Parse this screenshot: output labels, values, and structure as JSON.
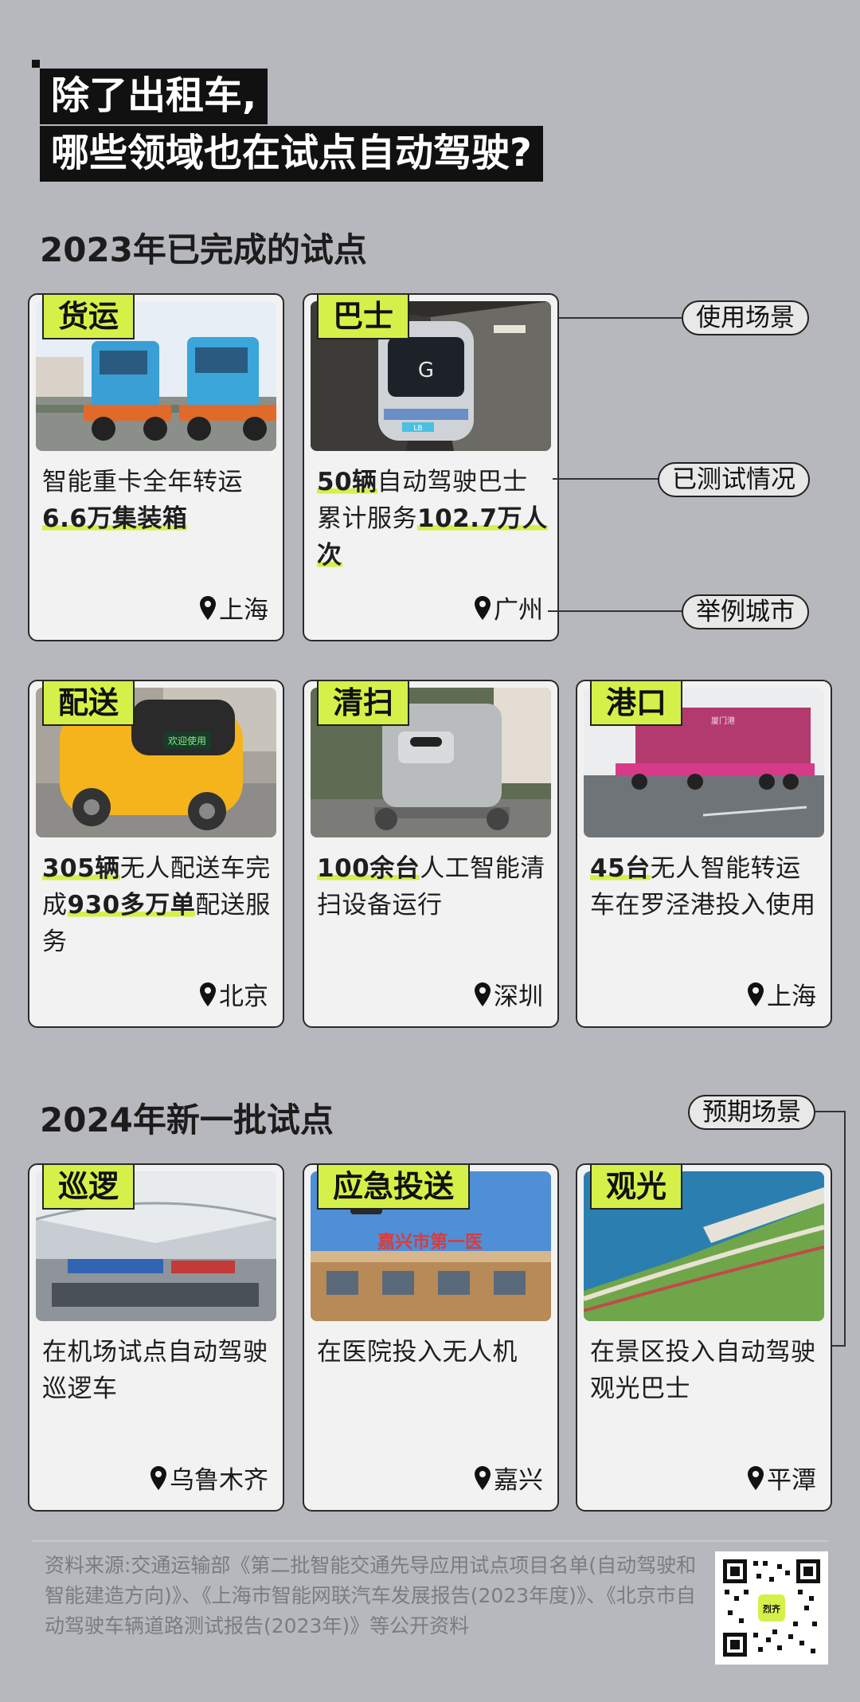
{
  "title": {
    "line1": "除了出租车,",
    "line2": "哪些领域也在试点自动驾驶?"
  },
  "section_2023": "2023年已完成的试点",
  "section_2024": "2024年新一批试点",
  "callouts": {
    "scene": "使用场景",
    "test": "已测试情况",
    "city": "举例城市",
    "expected": "预期场景"
  },
  "cards": [
    {
      "tag": "货运",
      "desc_parts": [
        {
          "t": "智能重卡全年转运",
          "hl": false
        },
        {
          "t": "6.6万集装箱",
          "hl": true
        }
      ],
      "city": "上海"
    },
    {
      "tag": "巴士",
      "desc_parts": [
        {
          "t": "50辆",
          "hl": true
        },
        {
          "t": "自动驾驶巴士累计服务",
          "hl": false
        },
        {
          "t": "102.7万人次",
          "hl": true
        }
      ],
      "city": "广州"
    },
    {
      "tag": "配送",
      "desc_parts": [
        {
          "t": "305辆",
          "hl": true
        },
        {
          "t": "无人配送车完成",
          "hl": false
        },
        {
          "t": "930多万单",
          "hl": true
        },
        {
          "t": "配送服务",
          "hl": false
        }
      ],
      "city": "北京"
    },
    {
      "tag": "清扫",
      "desc_parts": [
        {
          "t": "100余台",
          "hl": true
        },
        {
          "t": "人工智能清扫设备运行",
          "hl": false
        }
      ],
      "city": "深圳"
    },
    {
      "tag": "港口",
      "desc_parts": [
        {
          "t": "45台",
          "hl": true
        },
        {
          "t": "无人智能转运车在罗泾港投入使用",
          "hl": false
        }
      ],
      "city": "上海"
    },
    {
      "tag": "巡逻",
      "desc_parts": [
        {
          "t": "在机场试点自动驾驶巡逻车",
          "hl": false
        }
      ],
      "city": "乌鲁木齐"
    },
    {
      "tag": "应急投送",
      "desc_parts": [
        {
          "t": "在医院投入无人机",
          "hl": false
        }
      ],
      "city": "嘉兴"
    },
    {
      "tag": "观光",
      "desc_parts": [
        {
          "t": "在景区投入自动驾驶观光巴士",
          "hl": false
        }
      ],
      "city": "平潭"
    }
  ],
  "photo_text": {
    "bus_sign": "G",
    "bus_plate": "LB",
    "delivery_screen": "欢迎使用",
    "container_text": "厦门港",
    "hospital_sign": "嘉兴市第一医"
  },
  "qr_badge": "烈齐",
  "source": "资料来源:交通运输部《第二批智能交通先导应用试点项目名单(自动驾驶和智能建造方向)》、《上海市智能网联汽车发展报告(2023年度)》、《北京市自动驾驶车辆道路测试报告(2023年)》等公开资料",
  "colors": {
    "accent": "#d6f04a",
    "background": "#b7b8bd",
    "card": "#f2f2f2"
  }
}
